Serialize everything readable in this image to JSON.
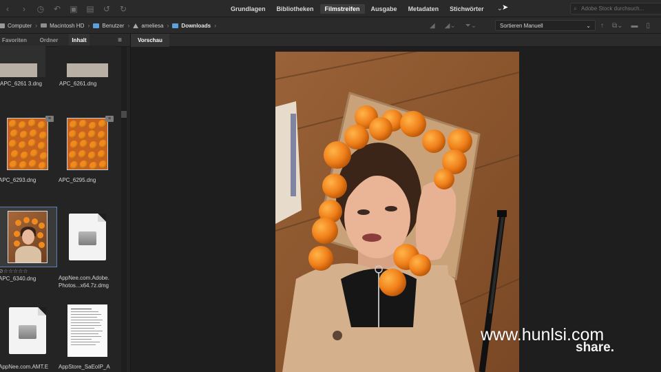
{
  "toolbar": {
    "workspaces": [
      "Grundlagen",
      "Bibliotheken",
      "Filmstreifen",
      "Ausgabe",
      "Metadaten",
      "Stichwörter"
    ],
    "active_workspace": "Filmstreifen",
    "search_placeholder": "Adobe Stock durchsuch..."
  },
  "path": {
    "crumbs": [
      "Computer",
      "Macintosh HD",
      "Benutzer",
      "ameliesa",
      "Downloads"
    ],
    "sort_label": "Sortieren Manuell"
  },
  "panel": {
    "tabs": [
      "Favoriten",
      "Ordner",
      "Inhalt"
    ],
    "active_tab": "Inhalt",
    "preview_tab": "Vorschau"
  },
  "files": [
    {
      "name": "APC_6261 3.dng"
    },
    {
      "name": "APC_6261.dng"
    },
    {
      "name": "APC_6293.dng"
    },
    {
      "name": "APC_6295.dng"
    },
    {
      "name": "APC_6340.dng",
      "rating_display": "⊘☆☆☆☆☆"
    },
    {
      "name": "AppNee.com.Adobe.\nPhotos...x64.7z.dmg"
    },
    {
      "name": "AppNee.com.AMT.E"
    },
    {
      "name": "AppStore_SaEoIP_A"
    }
  ],
  "watermark": {
    "text": "www.hunlsi.com",
    "overlay": "share."
  },
  "colors": {
    "accent_selected": "#5c7fb8",
    "folder": "#5da1dc",
    "orange": "#f08a1c"
  }
}
